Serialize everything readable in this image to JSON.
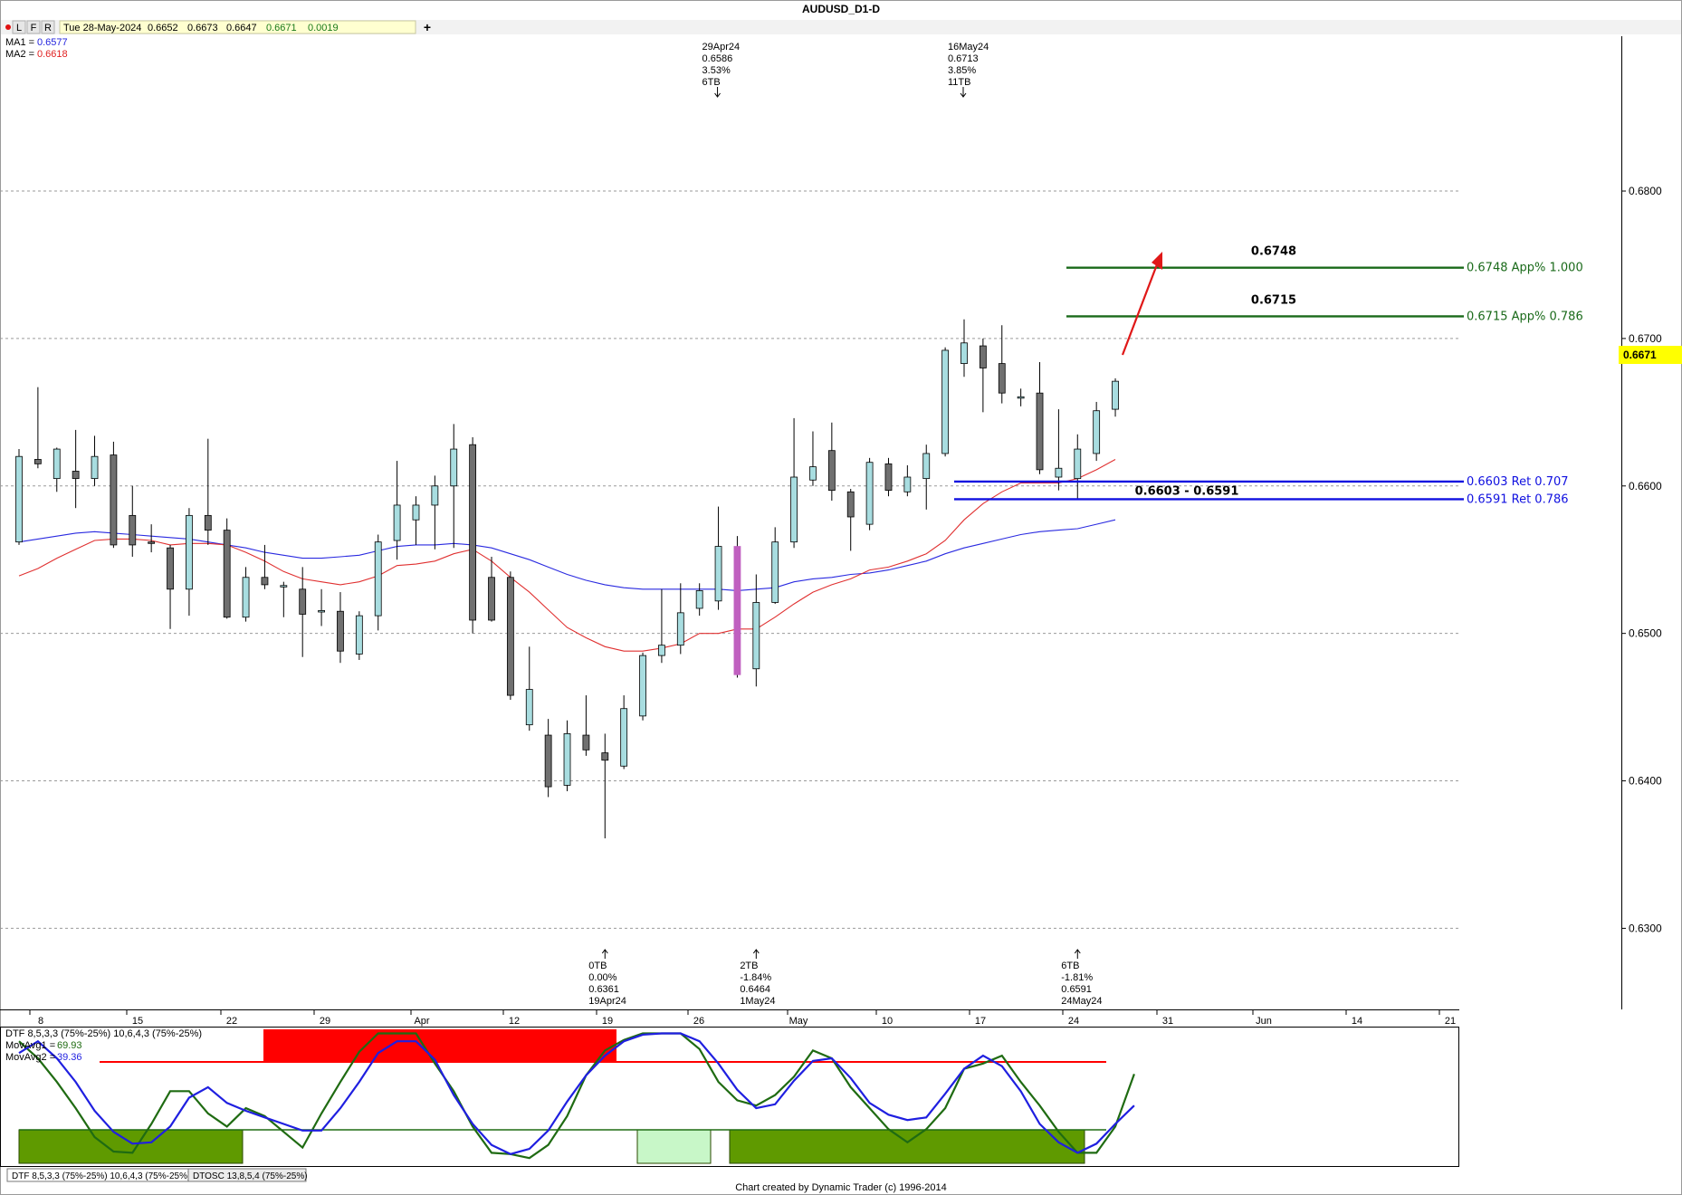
{
  "window": {
    "title": "AUDUSD_D1-D"
  },
  "toolbar": {
    "buttons": [
      "L",
      "F",
      "R"
    ],
    "info": {
      "date": "Tue 28-May-2024",
      "open": "0.6652",
      "high": "0.6673",
      "low": "0.6647",
      "close": "0.6671",
      "change": "0.0019"
    },
    "add_label": "+"
  },
  "legend": {
    "ma1_label": "MA1 =",
    "ma1_value": "0.6577",
    "ma1_color": "#1f1fdd",
    "ma2_label": "MA2 =",
    "ma2_value": "0.6618",
    "ma2_color": "#e02020"
  },
  "colors": {
    "up_candle": "#a8dde0",
    "down_candle": "#707070",
    "highlight_candle": "#c060c0",
    "ma1": "#2a2ae0",
    "ma2": "#e03030",
    "projection_green": "#1a6a1a",
    "retracement_blue": "#1010e0",
    "arrow_red": "#e01818",
    "price_highlight_bg": "#ffff00",
    "dtf_fast": "#1f6b12",
    "dtf_slow": "#1f1fe0",
    "dtf_high_zone": "#ff0000",
    "dtf_low_zone": "#5f9a00",
    "dtf_low_zone_light": "#c8f7c8"
  },
  "chart_data": {
    "type": "candlestick",
    "title": "AUDUSD_D1-D",
    "ylim": [
      0.6245,
      0.6905
    ],
    "y_ticks": [
      "0.6800",
      "0.6700",
      "0.6600",
      "0.6500",
      "0.6400",
      "0.6300"
    ],
    "last_price": "0.6671",
    "x_ticks": [
      "8",
      "15",
      "22",
      "29",
      "Apr",
      "12",
      "19",
      "26",
      "May",
      "10",
      "17",
      "24",
      "31",
      "Jun",
      "14",
      "21"
    ],
    "candles": [
      {
        "o": 0.6562,
        "h": 0.6625,
        "l": 0.656,
        "c": 0.662
      },
      {
        "o": 0.6618,
        "h": 0.6667,
        "l": 0.6612,
        "c": 0.6615
      },
      {
        "o": 0.6605,
        "h": 0.6626,
        "l": 0.6596,
        "c": 0.6625
      },
      {
        "o": 0.661,
        "h": 0.6638,
        "l": 0.6585,
        "c": 0.6605
      },
      {
        "o": 0.6605,
        "h": 0.6634,
        "l": 0.66,
        "c": 0.662
      },
      {
        "o": 0.6621,
        "h": 0.663,
        "l": 0.6558,
        "c": 0.656
      },
      {
        "o": 0.658,
        "h": 0.66,
        "l": 0.6552,
        "c": 0.656
      },
      {
        "o": 0.6562,
        "h": 0.6574,
        "l": 0.6555,
        "c": 0.6561
      },
      {
        "o": 0.6558,
        "h": 0.656,
        "l": 0.6503,
        "c": 0.653
      },
      {
        "o": 0.653,
        "h": 0.6585,
        "l": 0.6512,
        "c": 0.658
      },
      {
        "o": 0.658,
        "h": 0.6632,
        "l": 0.656,
        "c": 0.657
      },
      {
        "o": 0.657,
        "h": 0.6578,
        "l": 0.651,
        "c": 0.6511
      },
      {
        "o": 0.6511,
        "h": 0.6545,
        "l": 0.6508,
        "c": 0.6538
      },
      {
        "o": 0.6538,
        "h": 0.656,
        "l": 0.653,
        "c": 0.6533
      },
      {
        "o": 0.6532,
        "h": 0.6535,
        "l": 0.6511,
        "c": 0.6532
      },
      {
        "o": 0.653,
        "h": 0.6545,
        "l": 0.6484,
        "c": 0.6513
      },
      {
        "o": 0.6515,
        "h": 0.653,
        "l": 0.6505,
        "c": 0.6515
      },
      {
        "o": 0.6515,
        "h": 0.6528,
        "l": 0.648,
        "c": 0.6488
      },
      {
        "o": 0.6486,
        "h": 0.6515,
        "l": 0.6482,
        "c": 0.6512
      },
      {
        "o": 0.6512,
        "h": 0.6567,
        "l": 0.6502,
        "c": 0.6562
      },
      {
        "o": 0.6563,
        "h": 0.6617,
        "l": 0.655,
        "c": 0.6587
      },
      {
        "o": 0.6577,
        "h": 0.6593,
        "l": 0.656,
        "c": 0.6587
      },
      {
        "o": 0.6587,
        "h": 0.6607,
        "l": 0.6557,
        "c": 0.66
      },
      {
        "o": 0.66,
        "h": 0.6642,
        "l": 0.6558,
        "c": 0.6625
      },
      {
        "o": 0.6628,
        "h": 0.6633,
        "l": 0.65,
        "c": 0.6509
      },
      {
        "o": 0.6538,
        "h": 0.6552,
        "l": 0.6508,
        "c": 0.6509
      },
      {
        "o": 0.6538,
        "h": 0.6542,
        "l": 0.6455,
        "c": 0.6458
      },
      {
        "o": 0.6438,
        "h": 0.6491,
        "l": 0.6434,
        "c": 0.6462
      },
      {
        "o": 0.6431,
        "h": 0.6442,
        "l": 0.6389,
        "c": 0.6396
      },
      {
        "o": 0.6397,
        "h": 0.6441,
        "l": 0.6393,
        "c": 0.6432
      },
      {
        "o": 0.6431,
        "h": 0.6458,
        "l": 0.6417,
        "c": 0.6421
      },
      {
        "o": 0.6419,
        "h": 0.6432,
        "l": 0.6361,
        "c": 0.6414
      },
      {
        "o": 0.641,
        "h": 0.6458,
        "l": 0.6408,
        "c": 0.6449
      },
      {
        "o": 0.6444,
        "h": 0.6487,
        "l": 0.6441,
        "c": 0.6485
      },
      {
        "o": 0.6485,
        "h": 0.653,
        "l": 0.648,
        "c": 0.6492
      },
      {
        "o": 0.6492,
        "h": 0.6534,
        "l": 0.6486,
        "c": 0.6514
      },
      {
        "o": 0.6517,
        "h": 0.6534,
        "l": 0.6512,
        "c": 0.6529
      },
      {
        "o": 0.6522,
        "h": 0.6586,
        "l": 0.6516,
        "c": 0.6559
      },
      {
        "o": 0.6559,
        "h": 0.6566,
        "l": 0.647,
        "c": 0.6472
      },
      {
        "o": 0.6476,
        "h": 0.654,
        "l": 0.6464,
        "c": 0.6521
      },
      {
        "o": 0.6521,
        "h": 0.6572,
        "l": 0.652,
        "c": 0.6562
      },
      {
        "o": 0.6562,
        "h": 0.6646,
        "l": 0.6558,
        "c": 0.6606
      },
      {
        "o": 0.6604,
        "h": 0.6637,
        "l": 0.66,
        "c": 0.6613
      },
      {
        "o": 0.6624,
        "h": 0.6643,
        "l": 0.659,
        "c": 0.6597
      },
      {
        "o": 0.6596,
        "h": 0.6598,
        "l": 0.6556,
        "c": 0.6579
      },
      {
        "o": 0.6574,
        "h": 0.6619,
        "l": 0.657,
        "c": 0.6616
      },
      {
        "o": 0.6615,
        "h": 0.6619,
        "l": 0.6593,
        "c": 0.6597
      },
      {
        "o": 0.6596,
        "h": 0.6614,
        "l": 0.6593,
        "c": 0.6606
      },
      {
        "o": 0.6605,
        "h": 0.6628,
        "l": 0.6584,
        "c": 0.6622
      },
      {
        "o": 0.6622,
        "h": 0.6694,
        "l": 0.662,
        "c": 0.6692
      },
      {
        "o": 0.6683,
        "h": 0.6713,
        "l": 0.6674,
        "c": 0.6697
      },
      {
        "o": 0.6695,
        "h": 0.67,
        "l": 0.665,
        "c": 0.668
      },
      {
        "o": 0.6683,
        "h": 0.6709,
        "l": 0.6656,
        "c": 0.6663
      },
      {
        "o": 0.666,
        "h": 0.6666,
        "l": 0.6654,
        "c": 0.666
      },
      {
        "o": 0.6663,
        "h": 0.6684,
        "l": 0.6608,
        "c": 0.6611
      },
      {
        "o": 0.6606,
        "h": 0.6652,
        "l": 0.6597,
        "c": 0.6612
      },
      {
        "o": 0.6605,
        "h": 0.6635,
        "l": 0.6591,
        "c": 0.6625
      },
      {
        "o": 0.6622,
        "h": 0.6657,
        "l": 0.6617,
        "c": 0.6651
      },
      {
        "o": 0.6652,
        "h": 0.6673,
        "l": 0.6647,
        "c": 0.6671
      }
    ],
    "highlight_index": 38,
    "ma1": [
      0.6562,
      0.6564,
      0.6566,
      0.6568,
      0.6569,
      0.6568,
      0.6567,
      0.6566,
      0.6565,
      0.6564,
      0.6562,
      0.656,
      0.6558,
      0.6555,
      0.6553,
      0.6551,
      0.6551,
      0.6552,
      0.6553,
      0.6556,
      0.6559,
      0.656,
      0.656,
      0.6561,
      0.656,
      0.6558,
      0.6554,
      0.655,
      0.6545,
      0.654,
      0.6536,
      0.6533,
      0.6531,
      0.653,
      0.653,
      0.653,
      0.653,
      0.653,
      0.6529,
      0.653,
      0.6531,
      0.6535,
      0.6537,
      0.6538,
      0.654,
      0.6541,
      0.6543,
      0.6546,
      0.6549,
      0.6554,
      0.6558,
      0.6561,
      0.6564,
      0.6567,
      0.6569,
      0.657,
      0.6571,
      0.6574,
      0.6577
    ],
    "ma2": [
      0.6539,
      0.6544,
      0.6551,
      0.6557,
      0.6563,
      0.6564,
      0.6564,
      0.6563,
      0.656,
      0.6561,
      0.6561,
      0.656,
      0.6555,
      0.6549,
      0.6542,
      0.6537,
      0.6535,
      0.6533,
      0.6535,
      0.6539,
      0.6546,
      0.6547,
      0.6549,
      0.6554,
      0.6557,
      0.6549,
      0.6538,
      0.6528,
      0.6516,
      0.6504,
      0.6497,
      0.6491,
      0.6488,
      0.6488,
      0.649,
      0.6493,
      0.65,
      0.65,
      0.6503,
      0.6503,
      0.6511,
      0.652,
      0.6528,
      0.6533,
      0.6537,
      0.6543,
      0.6545,
      0.6549,
      0.6554,
      0.6563,
      0.6577,
      0.6588,
      0.6596,
      0.6602,
      0.6602,
      0.6602,
      0.6605,
      0.6611,
      0.6618
    ],
    "levels": [
      {
        "price": 0.6748,
        "label": "0.6748 App% 1.000",
        "callout": "0.6748",
        "style": "projection"
      },
      {
        "price": 0.6715,
        "label": "0.6715 App% 0.786",
        "callout": "0.6715",
        "style": "projection"
      },
      {
        "price": 0.6603,
        "label": "0.6603 Ret 0.707",
        "style": "retracement"
      },
      {
        "price": 0.6591,
        "label": "0.6591 Ret 0.786",
        "style": "retracement"
      }
    ],
    "zone_label": "0.6603 - 0.6591",
    "pivots_top": [
      {
        "lines": [
          "29Apr24",
          "0.6586",
          "3.53%",
          "6TB"
        ],
        "index": 37
      },
      {
        "lines": [
          "16May24",
          "0.6713",
          "3.85%",
          "11TB"
        ],
        "index": 50
      }
    ],
    "pivots_bottom": [
      {
        "lines": [
          "0TB",
          "0.00%",
          "0.6361",
          "19Apr24"
        ],
        "index": 31
      },
      {
        "lines": [
          "2TB",
          "-1.84%",
          "0.6464",
          "1May24"
        ],
        "index": 39
      },
      {
        "lines": [
          "6TB",
          "-1.81%",
          "0.6591",
          "24May24"
        ],
        "index": 56
      }
    ]
  },
  "oscillator": {
    "title": "DTF 8,5,3,3 (75%-25%) 10,6,4,3 (75%-25%)",
    "mavg1_label": "MovAvg1 =",
    "mavg1_value": "69.93",
    "mavg2_label": "MovAvg2 =",
    "mavg2_value": "39.36",
    "upper_threshold": 75,
    "lower_threshold": 25,
    "fast": [
      93,
      80,
      62,
      42,
      20,
      9,
      8,
      30,
      55,
      55,
      38,
      28,
      42,
      36,
      24,
      12,
      38,
      62,
      85,
      99,
      99,
      99,
      76,
      55,
      28,
      8,
      7,
      4,
      14,
      36,
      67,
      86,
      94,
      99,
      99,
      99,
      87,
      62,
      48,
      44,
      52,
      66,
      86,
      80,
      58,
      42,
      26,
      16,
      26,
      42,
      72,
      76,
      82,
      62,
      44,
      24,
      8,
      8,
      28,
      68
    ],
    "slow": [
      84,
      93,
      80,
      62,
      40,
      24,
      15,
      16,
      28,
      50,
      58,
      46,
      40,
      35,
      30,
      25,
      25,
      42,
      62,
      84,
      93,
      93,
      79,
      52,
      30,
      14,
      7,
      11,
      25,
      47,
      67,
      82,
      93,
      98,
      99,
      99,
      93,
      76,
      56,
      42,
      45,
      63,
      78,
      80,
      65,
      46,
      37,
      33,
      35,
      53,
      72,
      82,
      74,
      55,
      30,
      16,
      8,
      15,
      30,
      44
    ]
  },
  "tabs": {
    "items": [
      "DTF 8,5,3,3 (75%-25%) 10,6,4,3 (75%-25%)",
      "DTOSC 13,8,5,4 (75%-25%)"
    ]
  },
  "footer": {
    "credit": "Chart created by Dynamic Trader  (c)  1996-2014"
  }
}
